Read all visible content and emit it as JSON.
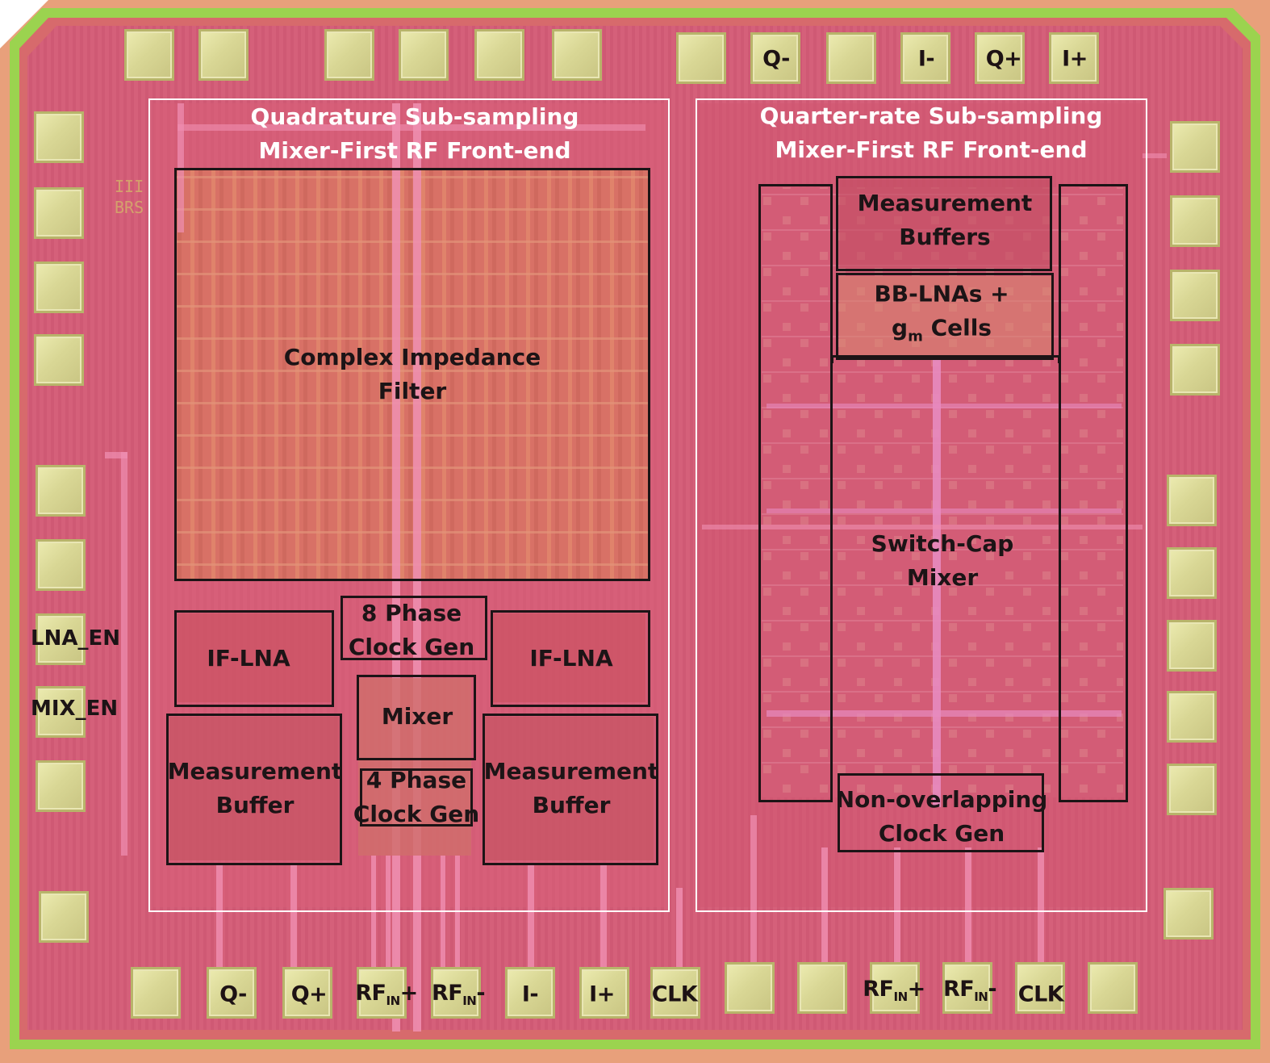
{
  "colors": {
    "die": "#d9617a",
    "pad": "#dcd99a",
    "outline": "#1c1416",
    "region_outline": "#ffffff",
    "seal_ring": "#a6d84a"
  },
  "regions": {
    "left_title_line1": "Quadrature Sub-sampling",
    "left_title_line2": "Mixer-First RF Front-end",
    "right_title_line1": "Quarter-rate Sub-sampling",
    "right_title_line2": "Mixer-First RF Front-end"
  },
  "blocks": {
    "filter_l1": "Complex Impedance",
    "filter_l2": "Filter",
    "phase8_l1": "8 Phase",
    "phase8_l2": "Clock Gen",
    "iflna_left": "IF-LNA",
    "iflna_right": "IF-LNA",
    "mixer": "Mixer",
    "phase4_l1": "4 Phase",
    "phase4_l2": "Clock Gen",
    "mbuf_left_l1": "Measurement",
    "mbuf_left_l2": "Buffer",
    "mbuf_right_l1": "Measurement",
    "mbuf_right_l2": "Buffer",
    "meas_buffers_l1": "Measurement",
    "meas_buffers_l2": "Buffers",
    "bblna_l1": "BB-LNAs +",
    "bblna_gm": "g",
    "bblna_gm_sub": "m",
    "bblna_cells": " Cells",
    "switchcap_l1": "Switch-Cap",
    "switchcap_l2": "Mixer",
    "nonoverlap_l1": "Non-overlapping",
    "nonoverlap_l2": "Clock Gen"
  },
  "side_labels": {
    "lna_en": "LNA_EN",
    "mix_en": "MIX_EN"
  },
  "top_pads": {
    "q_minus": "Q-",
    "i_minus": "I-",
    "q_plus": "Q+",
    "i_plus": "I+"
  },
  "bottom_pads": {
    "q_minus": "Q-",
    "q_plus": "Q+",
    "rfin1_main": "RF",
    "rfin1_sub": "IN",
    "rfin1_sign": "+",
    "rfin2_main": "RF",
    "rfin2_sub": "IN",
    "rfin2_sign": "-",
    "i_minus": "I-",
    "i_plus": "I+",
    "clk1": "CLK",
    "rfin3_main": "RF",
    "rfin3_sub": "IN",
    "rfin3_sign": "+",
    "rfin4_main": "RF",
    "rfin4_sub": "IN",
    "rfin4_sign": "-",
    "clk2": "CLK"
  }
}
